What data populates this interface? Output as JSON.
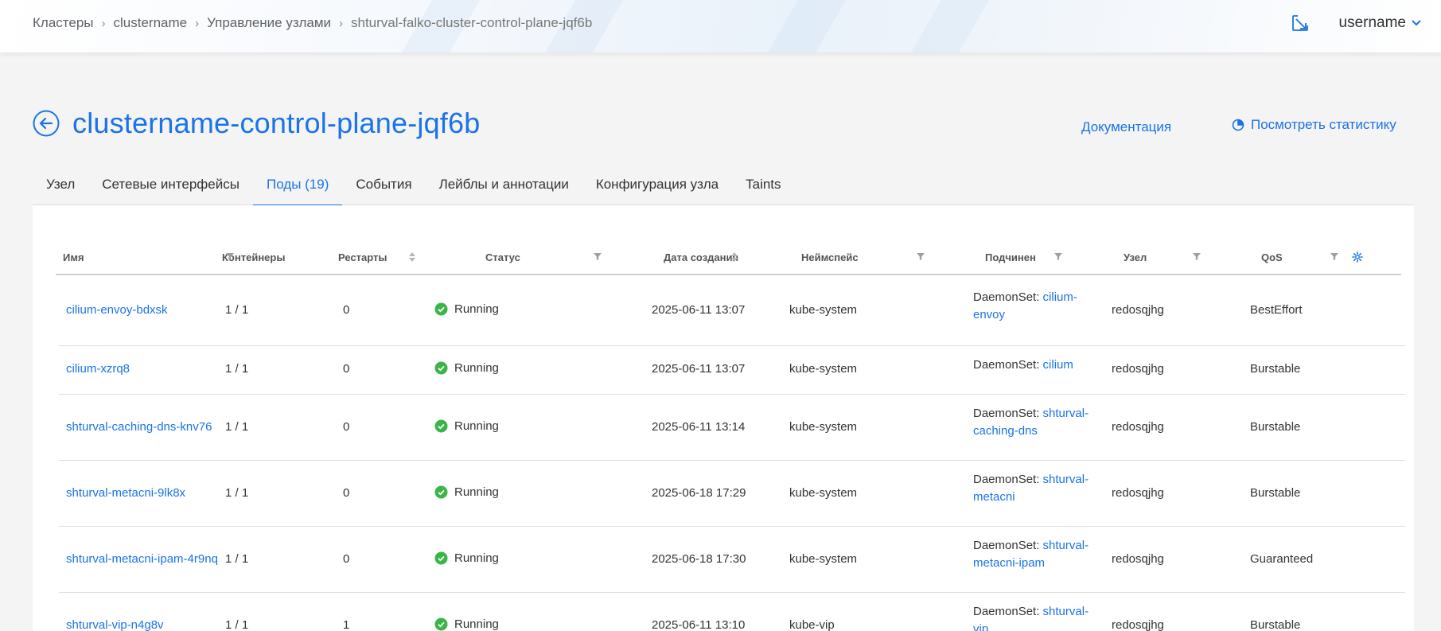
{
  "breadcrumb": [
    "Кластеры",
    "clustername",
    "Управление узлами",
    "shturval-falko-cluster-control-plane-jqf6b"
  ],
  "user": {
    "name": "username"
  },
  "page": {
    "title": "clustername-control-plane-jqf6b",
    "doc_link": "Документация",
    "stats_link": "Посмотреть статистику"
  },
  "tabs": [
    {
      "label": "Узел",
      "active": false
    },
    {
      "label": "Сетевые интерфейсы",
      "active": false
    },
    {
      "label": "Поды (19)",
      "active": true
    },
    {
      "label": "События",
      "active": false
    },
    {
      "label": "Лейблы и аннотации",
      "active": false
    },
    {
      "label": "Конфигурация узла",
      "active": false
    },
    {
      "label": "Taints",
      "active": false
    }
  ],
  "table": {
    "columns": [
      "Имя",
      "Контейнеры",
      "Рестарты",
      "Статус",
      "Дата создания",
      "Неймспейс",
      "Подчинен",
      "Узел",
      "QoS"
    ],
    "owner_prefix": "DaemonSet: ",
    "rows": [
      {
        "name": "cilium-envoy-bdxsk",
        "containers": "1 / 1",
        "restarts": "0",
        "status": "Running",
        "created": "2025-06-11 13:07",
        "namespace": "kube-system",
        "owner_line1": "cilium-",
        "owner_line2": "envoy",
        "node": "redosqjhg",
        "qos": "BestEffort"
      },
      {
        "name": "cilium-xzrq8",
        "containers": "1 / 1",
        "restarts": "0",
        "status": "Running",
        "created": "2025-06-11 13:07",
        "namespace": "kube-system",
        "owner_line1": "cilium",
        "owner_line2": "",
        "node": "redosqjhg",
        "qos": "Burstable"
      },
      {
        "name": "shturval-caching-dns-knv76",
        "containers": "1 / 1",
        "restarts": "0",
        "status": "Running",
        "created": "2025-06-11 13:14",
        "namespace": "kube-system",
        "owner_line1": "shturval-",
        "owner_line2": "caching-dns",
        "node": "redosqjhg",
        "qos": "Burstable"
      },
      {
        "name": "shturval-metacni-9lk8x",
        "containers": "1 / 1",
        "restarts": "0",
        "status": "Running",
        "created": "2025-06-18 17:29",
        "namespace": "kube-system",
        "owner_line1": "shturval-",
        "owner_line2": "metacni",
        "node": "redosqjhg",
        "qos": "Burstable"
      },
      {
        "name": "shturval-metacni-ipam-4r9nq",
        "containers": "1 / 1",
        "restarts": "0",
        "status": "Running",
        "created": "2025-06-18 17:30",
        "namespace": "kube-system",
        "owner_line1": "shturval-",
        "owner_line2": "metacni-ipam",
        "node": "redosqjhg",
        "qos": "Guaranteed"
      },
      {
        "name": "shturval-vip-n4g8v",
        "containers": "1 / 1",
        "restarts": "1",
        "status": "Running",
        "created": "2025-06-11 13:10",
        "namespace": "kube-vip",
        "owner_line1": "shturval-",
        "owner_line2": "vip",
        "node": "redosqjhg",
        "qos": "Burstable"
      }
    ]
  },
  "colors": {
    "accent": "#1a73e8",
    "status_ok": "#3bb54a"
  },
  "icons": {
    "expand": "expand-window-icon",
    "chevron": "chevron-down-icon",
    "back": "arrow-left-circle-icon",
    "stats": "pie-chart-icon",
    "filter": "filter-icon",
    "sort": "sort-icon",
    "settings": "gear-icon",
    "status": "check-circle-icon"
  }
}
